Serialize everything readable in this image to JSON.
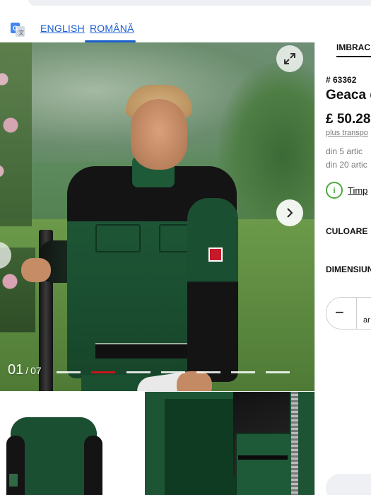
{
  "translate": {
    "icon": "google-translate-icon",
    "languages": [
      {
        "label": "ENGLISH",
        "active": false
      },
      {
        "label": "ROMÂNĂ",
        "active": true
      }
    ]
  },
  "gallery": {
    "current": "01",
    "separator": "/",
    "total": "07",
    "dots_active_index": 1,
    "dots_count": 7
  },
  "product": {
    "category_tab": "IMBRAC",
    "sku": "# 63362",
    "title": "Geaca d",
    "price": "£ 50.28",
    "shipping_link": "plus transpo",
    "bulk_price_1": "din 5 artic",
    "bulk_price_2": "din 20 artic",
    "delivery_link": "Timp",
    "color_label": "CULOARE",
    "size_label": "DIMENSIUN",
    "quantity_minus": "−",
    "quantity_unit": "ar"
  },
  "colors": {
    "link": "#1a5fd0",
    "accent_red": "#c4161c",
    "jacket_green": "#1b4f31",
    "info_green": "#4caa3a"
  }
}
